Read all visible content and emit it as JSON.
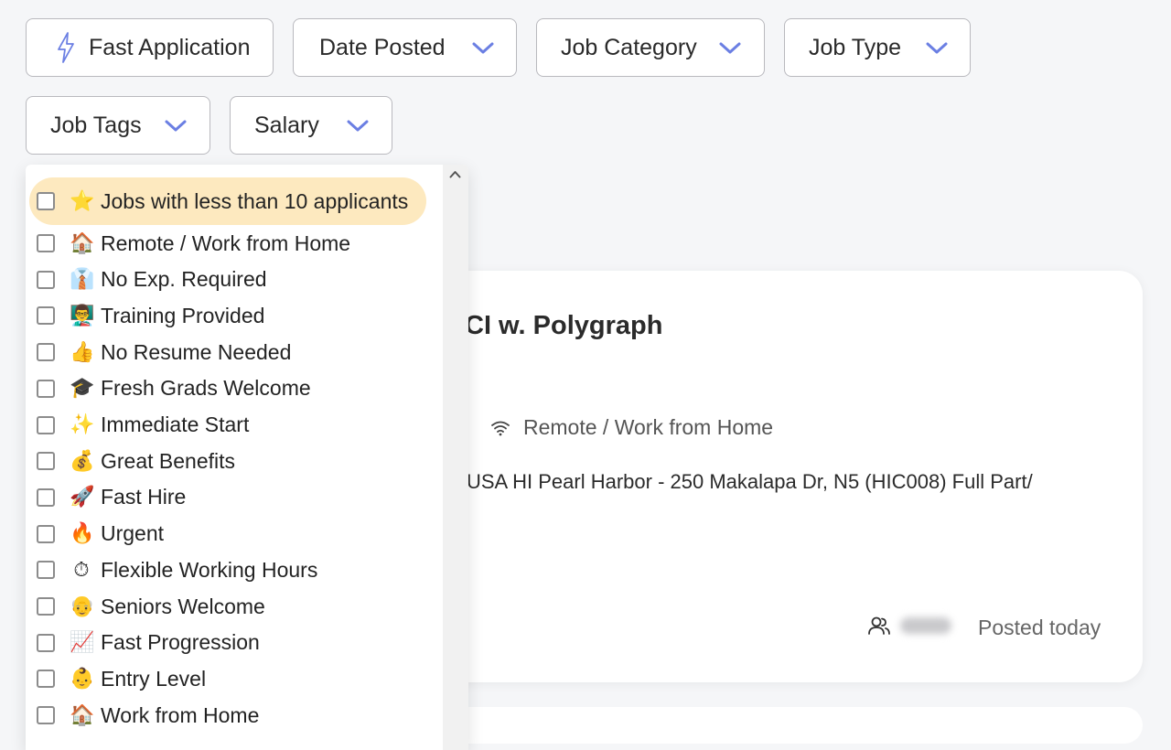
{
  "filters": {
    "fast_application": "Fast Application",
    "date_posted": "Date Posted",
    "job_category": "Job Category",
    "job_type": "Job Type",
    "job_tags": "Job Tags",
    "salary": "Salary"
  },
  "job_card": {
    "title_visible": "CI w. Polygraph",
    "work_mode": "Remote / Work from Home",
    "location": "USA HI Pearl Harbor - 250 Makalapa Dr, N5 (HIC008) Full Part/",
    "posted": "Posted today"
  },
  "job_tags_dropdown": {
    "items": [
      {
        "label": "Jobs with less than 10 applicants",
        "emoji": "⭐",
        "highlighted": true
      },
      {
        "label": "Remote / Work from Home",
        "emoji": "🏠"
      },
      {
        "label": "No Exp. Required",
        "emoji": "👔"
      },
      {
        "label": "Training Provided",
        "emoji": "👨‍🏫"
      },
      {
        "label": "No Resume Needed",
        "emoji": "👍"
      },
      {
        "label": "Fresh Grads Welcome",
        "emoji": "🎓"
      },
      {
        "label": "Immediate Start",
        "emoji": "✨"
      },
      {
        "label": "Great Benefits",
        "emoji": "💰"
      },
      {
        "label": "Fast Hire",
        "emoji": "🚀"
      },
      {
        "label": "Urgent",
        "emoji": "🔥"
      },
      {
        "label": "Flexible Working Hours",
        "emoji": "⏱"
      },
      {
        "label": "Seniors Welcome",
        "emoji": "👴"
      },
      {
        "label": "Fast Progression",
        "emoji": "📈"
      },
      {
        "label": "Entry Level",
        "emoji": "👶"
      },
      {
        "label": "Work from Home",
        "emoji": "🏠"
      }
    ]
  },
  "colors": {
    "accent": "#6b7fe3",
    "highlight": "#fde9bf"
  }
}
